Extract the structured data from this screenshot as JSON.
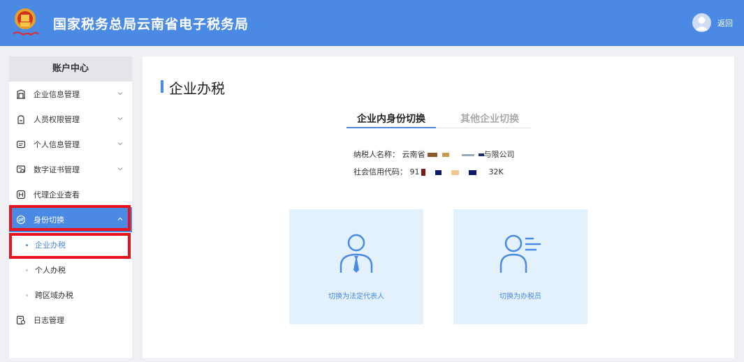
{
  "header": {
    "title": "国家税务总局云南省电子税务局",
    "back_label": "返回"
  },
  "sidebar": {
    "heading": "账户中心",
    "items": [
      {
        "label": "企业信息管理",
        "icon": "building-icon",
        "expandable": true
      },
      {
        "label": "人员权限管理",
        "icon": "person-lock-icon",
        "expandable": true
      },
      {
        "label": "个人信息管理",
        "icon": "id-card-icon",
        "expandable": true
      },
      {
        "label": "数字证书管理",
        "icon": "certificate-icon",
        "expandable": true
      },
      {
        "label": "代理企业查看",
        "icon": "agency-icon",
        "expandable": false
      },
      {
        "label": "身份切换",
        "icon": "switch-identity-icon",
        "expandable": true,
        "expanded": true,
        "active": true
      },
      {
        "label": "日志管理",
        "icon": "log-icon",
        "expandable": false
      }
    ],
    "subitems": [
      {
        "label": "企业办税",
        "current": true
      },
      {
        "label": "个人办税",
        "current": false
      },
      {
        "label": "跨区域办税",
        "current": false
      }
    ]
  },
  "main": {
    "title": "企业办税",
    "tabs": [
      {
        "label": "企业内身份切换",
        "active": true
      },
      {
        "label": "其他企业切换",
        "active": false
      }
    ],
    "taxpayer": {
      "name_label": "纳税人名称：",
      "name_visible_start": "云南省",
      "name_visible_end": "与限公司",
      "code_label": "社会信用代码：",
      "code_visible_start": "91",
      "code_visible_end": "32K"
    },
    "cards": [
      {
        "label": "切换为法定代表人",
        "icon": "legal-representative-icon"
      },
      {
        "label": "切换为办税员",
        "icon": "tax-agent-icon"
      }
    ]
  },
  "colors": {
    "header_bg": "#4a8ae4",
    "accent": "#4a8ae4",
    "highlight_box": "#e8101a",
    "card_bg": "#e2f1fb",
    "page_bg": "#eef0f3"
  }
}
